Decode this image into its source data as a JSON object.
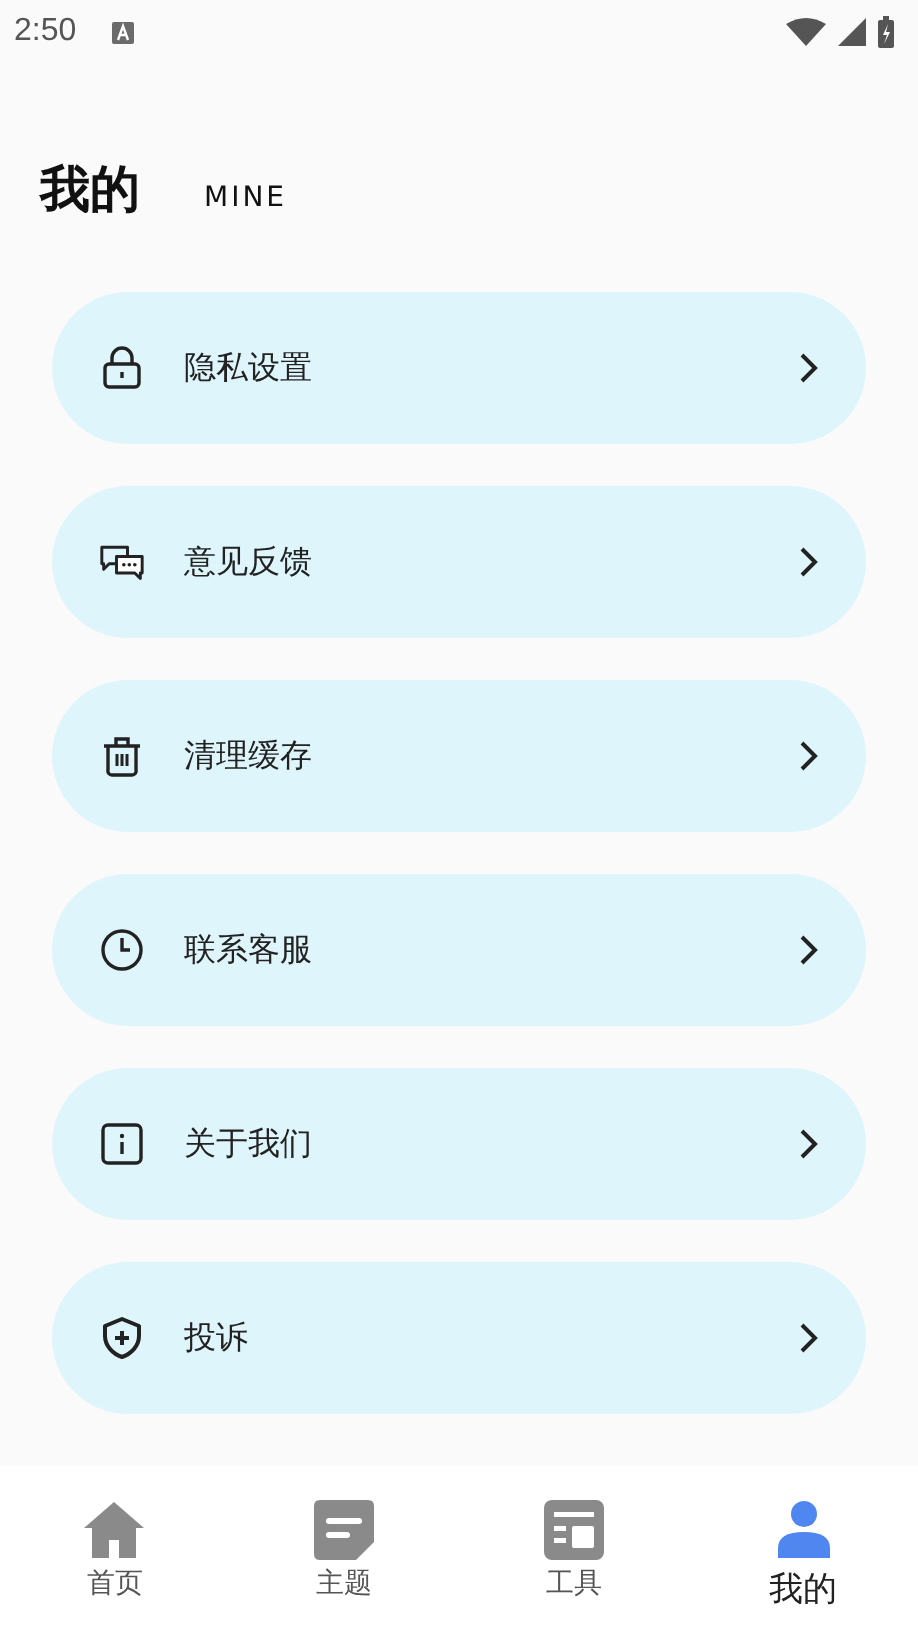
{
  "status_bar": {
    "time": "2:50"
  },
  "header": {
    "title": "我的",
    "subtitle": "MINE"
  },
  "menu_items": [
    {
      "kind": "lock",
      "label": "隐私设置"
    },
    {
      "kind": "chat",
      "label": "意见反馈"
    },
    {
      "kind": "trash",
      "label": "清理缓存"
    },
    {
      "kind": "clock",
      "label": "联系客服"
    },
    {
      "kind": "info",
      "label": "关于我们"
    },
    {
      "kind": "shield",
      "label": "投诉"
    }
  ],
  "tabs": [
    {
      "kind": "home",
      "label": "首页",
      "selected": false
    },
    {
      "kind": "note",
      "label": "主题",
      "selected": false
    },
    {
      "kind": "tools",
      "label": "工具",
      "selected": false
    },
    {
      "kind": "person",
      "label": "我的",
      "selected": true
    }
  ]
}
